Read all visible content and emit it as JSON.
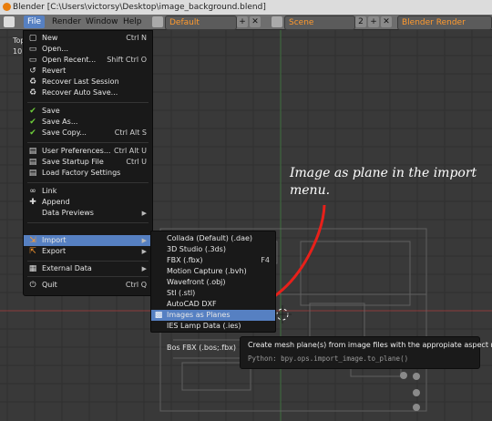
{
  "window": {
    "title": "Blender [C:\\Users\\victorsy\\Desktop\\image_background.blend]"
  },
  "header": {
    "menus": [
      "File",
      "Render",
      "Window",
      "Help"
    ],
    "layout": "Default",
    "scene": "Scene",
    "engine": "Blender Render",
    "add_label": "+",
    "close_label": "✕",
    "scene_users": "2"
  },
  "viewport": {
    "view_label": "Top",
    "scale_label": "10"
  },
  "file_menu": [
    {
      "label": "New",
      "shortcut": "Ctrl N",
      "icon": "new-file-icon"
    },
    {
      "label": "Open...",
      "shortcut": "",
      "icon": "open-folder-icon"
    },
    {
      "label": "Open Recent...",
      "shortcut": "Shift Ctrl O",
      "icon": "recent-file-icon"
    },
    {
      "label": "Revert",
      "shortcut": "",
      "icon": "revert-icon"
    },
    {
      "label": "Recover Last Session",
      "shortcut": "",
      "icon": "recover-icon"
    },
    {
      "label": "Recover Auto Save...",
      "shortcut": "",
      "icon": "recover-autosave-icon"
    },
    {
      "label": "Save",
      "shortcut": "",
      "icon": "save-check-icon"
    },
    {
      "label": "Save As...",
      "shortcut": "",
      "icon": "save-as-icon"
    },
    {
      "label": "Save Copy...",
      "shortcut": "Ctrl Alt S",
      "icon": "save-copy-icon"
    },
    {
      "label": "User Preferences...",
      "shortcut": "Ctrl Alt U",
      "icon": "preferences-icon"
    },
    {
      "label": "Save Startup File",
      "shortcut": "Ctrl U",
      "icon": "save-startup-icon"
    },
    {
      "label": "Load Factory Settings",
      "shortcut": "",
      "icon": "load-factory-icon"
    },
    {
      "label": "Link",
      "shortcut": "",
      "icon": "link-icon"
    },
    {
      "label": "Append",
      "shortcut": "",
      "icon": "append-icon"
    },
    {
      "label": "Data Previews",
      "shortcut": "",
      "icon": ""
    },
    {
      "label": "Import",
      "shortcut": "",
      "icon": "import-icon"
    },
    {
      "label": "Export",
      "shortcut": "",
      "icon": "export-icon"
    },
    {
      "label": "External Data",
      "shortcut": "",
      "icon": "external-data-icon"
    },
    {
      "label": "Quit",
      "shortcut": "Ctrl Q",
      "icon": "quit-icon"
    }
  ],
  "import_menu": [
    {
      "label": "Collada (Default) (.dae)",
      "shortcut": ""
    },
    {
      "label": "3D Studio (.3ds)",
      "shortcut": ""
    },
    {
      "label": "FBX (.fbx)",
      "shortcut": "F4"
    },
    {
      "label": "Motion Capture (.bvh)",
      "shortcut": ""
    },
    {
      "label": "Wavefront (.obj)",
      "shortcut": ""
    },
    {
      "label": "Stl (.stl)",
      "shortcut": ""
    },
    {
      "label": "AutoCAD DXF",
      "shortcut": ""
    },
    {
      "label": "Images as Planes",
      "shortcut": ""
    },
    {
      "label": "IES Lamp Data (.ies)",
      "shortcut": ""
    },
    {
      "label": "Bos FBX (.bos;.fbx)",
      "shortcut": ""
    }
  ],
  "tooltip": {
    "description": "Create mesh plane(s) from image files with the appropiate aspect ratio",
    "python": "Python: bpy.ops.import_image.to_plane()"
  },
  "annotation": {
    "line1": "Image as plane in the import",
    "line2": "menu."
  },
  "colors": {
    "accent": "#5680c2",
    "arrow": "#e8201a",
    "header_highlight": "#ff9a2e"
  }
}
